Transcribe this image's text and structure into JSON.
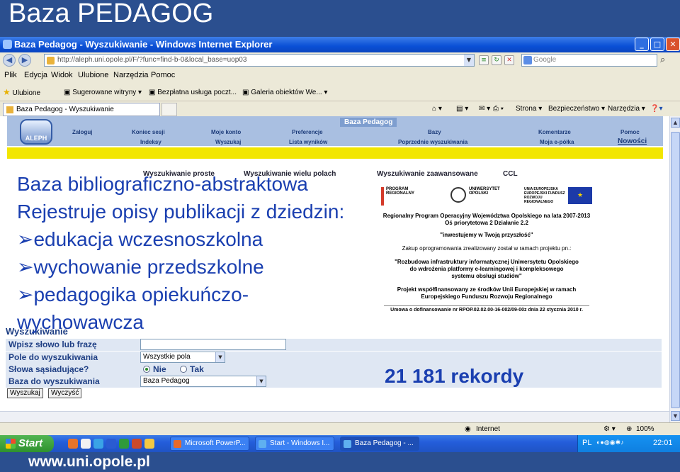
{
  "slide": {
    "title": "Baza PEDAGOG",
    "footer_url": "www.uni.opole.pl"
  },
  "window": {
    "title": "Baza Pedagog - Wyszukiwanie - Windows Internet Explorer",
    "minimize": "_",
    "maximize": "□",
    "close": "✕"
  },
  "browser": {
    "address": "http://aleph.uni.opole.pl/F/?func=find-b-0&local_base=uop03",
    "search_placeholder": "Google",
    "menu": [
      "Plik",
      "Edycja",
      "Widok",
      "Ulubione",
      "Narzędzia",
      "Pomoc"
    ],
    "favorites": {
      "label": "Ulubione",
      "items": [
        "Sugerowane witryny",
        "Bezpłatna usługa poczt...",
        "Galeria obiektów We..."
      ]
    },
    "tab": "Baza Pedagog - Wyszukiwanie",
    "commands": [
      "Strona",
      "Bezpieczeństwo",
      "Narzędzia"
    ]
  },
  "aleph": {
    "logo": "ALEPH",
    "title": "Baza Pedagog",
    "nav_top": [
      "Zaloguj",
      "Koniec sesji",
      "Moje konto",
      "Preferencje",
      "Bazy",
      "Komentarze",
      "Pomoc"
    ],
    "nav_bottom": [
      "Indeksy",
      "Wyszukaj",
      "Lista wyników",
      "Poprzednie wyszukiwania",
      "Moja e-półka",
      "Nowości"
    ],
    "search_tabs": [
      "Wyszukiwanie proste",
      "Wyszukiwanie wielu polach",
      "Wyszukiwanie zaawansowane",
      "CCL"
    ]
  },
  "overlay": {
    "lines": [
      "Baza bibliograficzno-abstraktowa",
      "Rejestruje opisy publikacji z dziedzin:",
      "➢edukacja wczesnoszkolna",
      "➢wychowanie przedszkolne",
      "➢pedagogika opiekuńczo-",
      "wychowawcza"
    ],
    "records": "21 181 rekordy"
  },
  "eu": {
    "logo_program": "PROGRAM REGIONALNY",
    "logo_uni": "UNIWERSYTET OPOLSKI",
    "logo_ue": "UNIA EUROPEJSKA EUROPEJSKI FUNDUSZ ROZWOJU REGIONALNEGO",
    "lines": [
      "Regionalny Program Operacyjny Województwa Opolskiego na lata 2007-2013",
      "Oś priorytetowa 2   Działanie 2.2",
      "\"inwestujemy w Twoją przyszłość\"",
      "Zakup oprogramowania zrealizowany został w ramach projektu pn.:",
      "\"Rozbudowa infrastruktury informatycznej Uniwersytetu Opolskiego",
      "do wdrożenia platformy e-learningowej i kompleksowego",
      "systemu obsługi studiów\"",
      "Projekt współfinansowany ze środków Unii Europejskiej w ramach",
      "Europejskiego Funduszu Rozwoju Regionalnego",
      "Umowa o dofinansowanie nr RPOP.02.02.00-16-002/09-00z dnia 22 stycznia 2010 r."
    ]
  },
  "form": {
    "heading": "Wyszukiwanie",
    "word_label": "Wpisz słowo lub frazę",
    "word_value": "",
    "field_label": "Pole do wyszukiwania",
    "field_value": "Wszystkie pola",
    "adjacent_label": "Słowa sąsiadujące?",
    "adjacent_no": "Nie",
    "adjacent_yes": "Tak",
    "base_label": "Baza do wyszukiwania",
    "base_value": "Baza Pedagog",
    "search_btn": "Wyszukaj",
    "clear_btn": "Wyczyść"
  },
  "status": {
    "zone": "Internet",
    "zoom": "100%"
  },
  "taskbar": {
    "start": "Start",
    "tasks": [
      "Microsoft PowerP...",
      "Start - Windows I...",
      "Baza Pedagog - ..."
    ],
    "lang": "PL",
    "clock": "22:01"
  }
}
